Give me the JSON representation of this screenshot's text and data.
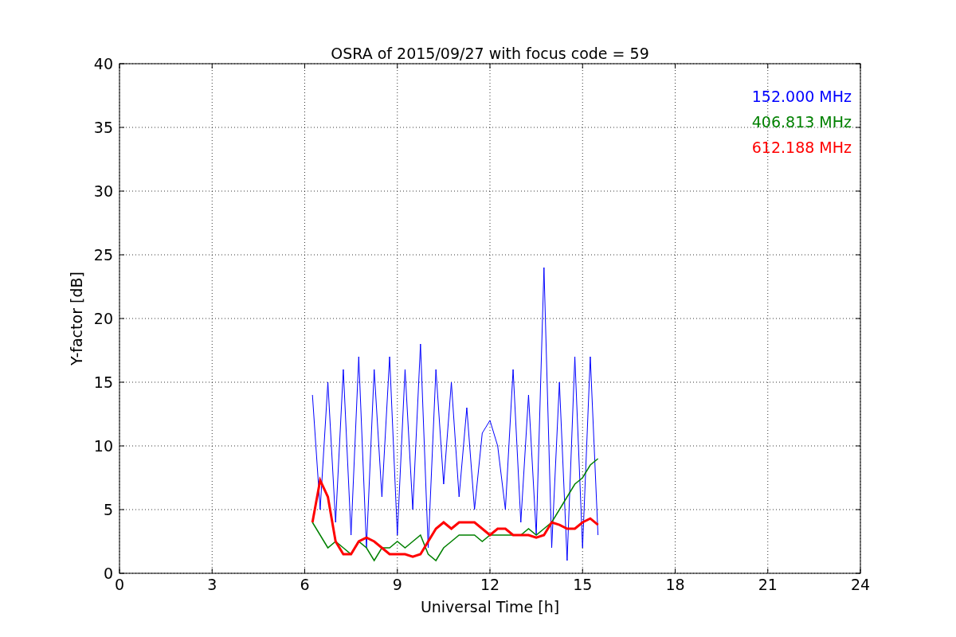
{
  "chart_data": {
    "type": "line",
    "title": "OSRA of 2015/09/27 with focus code = 59",
    "xlabel": "Universal Time [h]",
    "ylabel": "Y-factor [dB]",
    "x": [
      6.25,
      6.5,
      6.75,
      7,
      7.25,
      7.5,
      7.75,
      8,
      8.25,
      8.5,
      8.75,
      9,
      9.25,
      9.5,
      9.75,
      10,
      10.25,
      10.5,
      10.75,
      11,
      11.25,
      11.5,
      11.75,
      12,
      12.25,
      12.5,
      12.75,
      13,
      13.25,
      13.5,
      13.75,
      14,
      14.25,
      14.5,
      14.75,
      15,
      15.25,
      15.5
    ],
    "series": [
      {
        "name": "152.000 MHz",
        "color": "#0000ff",
        "values": [
          14,
          5,
          15,
          4,
          16,
          3,
          17,
          2,
          16,
          6,
          17,
          3,
          16,
          5,
          18,
          2,
          16,
          7,
          15,
          6,
          13,
          5,
          11,
          12,
          10,
          5,
          16,
          4,
          14,
          3,
          24,
          2,
          15,
          1,
          17,
          2,
          17,
          3
        ]
      },
      {
        "name": "406.813 MHz",
        "color": "#008000",
        "values": [
          4,
          3,
          2,
          2.5,
          2,
          1.5,
          2.5,
          2,
          1,
          2,
          2,
          2.5,
          2,
          2.5,
          3,
          1.5,
          1,
          2,
          2.5,
          3,
          3,
          3,
          2.5,
          3,
          3,
          3,
          3,
          3,
          3.5,
          3,
          3.5,
          4,
          5,
          6,
          7,
          7.5,
          8.5,
          9
        ]
      },
      {
        "name": "612.188 MHz",
        "color": "#ff0000",
        "values": [
          4,
          7.3,
          6,
          2.5,
          1.5,
          1.5,
          2.5,
          2.8,
          2.5,
          2,
          1.5,
          1.5,
          1.5,
          1.3,
          1.5,
          2.5,
          3.5,
          4,
          3.5,
          4,
          4,
          4,
          3.5,
          3,
          3.5,
          3.5,
          3,
          3,
          3,
          2.8,
          3,
          4,
          3.8,
          3.5,
          3.5,
          4,
          4.3,
          3.8
        ]
      }
    ],
    "xlim": [
      0,
      24
    ],
    "ylim": [
      0,
      40
    ],
    "xticks": [
      0,
      3,
      6,
      9,
      12,
      15,
      18,
      21,
      24
    ],
    "yticks": [
      0,
      5,
      10,
      15,
      20,
      25,
      30,
      35,
      40
    ],
    "grid": true
  }
}
